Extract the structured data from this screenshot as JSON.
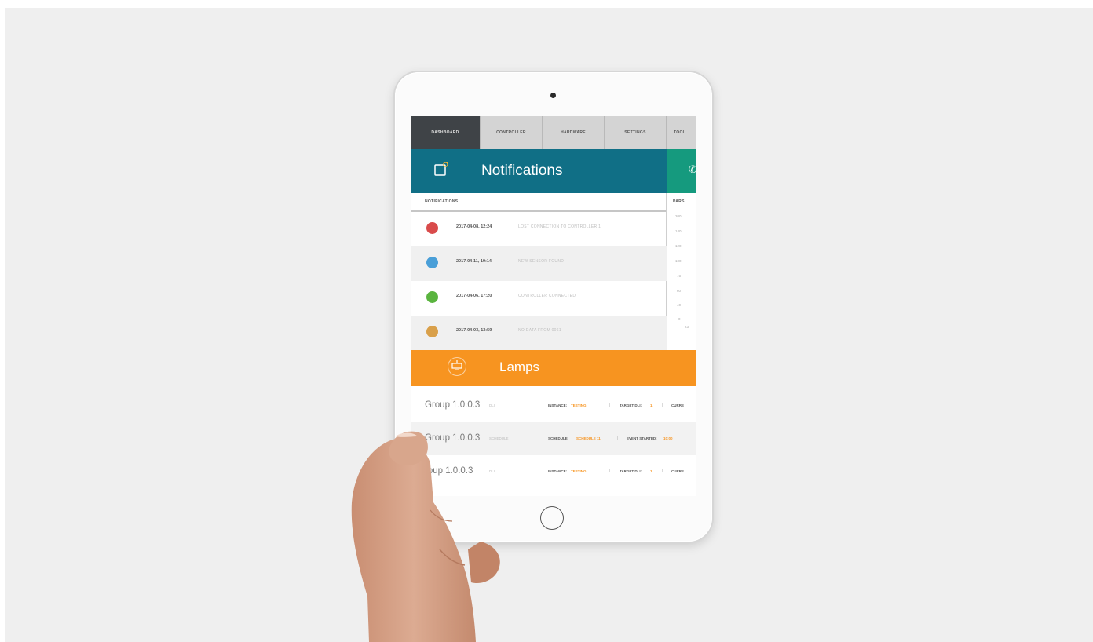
{
  "tabs": [
    "DASHBOARD",
    "CONTROLLER",
    "HARDWARE",
    "SETTINGS",
    "TOOL"
  ],
  "notifications": {
    "title": "Notifications",
    "column_label": "NOTIFICATIONS",
    "side_column_label": "PARS",
    "rows": [
      {
        "date": "2017-04-08, 12:24",
        "message": "LOST CONNECTION TO CONTROLLER 1",
        "color": "#d94b4b"
      },
      {
        "date": "2017-04-11, 19:14",
        "message": "NEW SENSOR FOUND",
        "color": "#4a9fd8"
      },
      {
        "date": "2017-04-06, 17:20",
        "message": "CONTROLLER CONNECTED",
        "color": "#5ab43f"
      },
      {
        "date": "2017-04-03, 13:59",
        "message": "NO DATA FROM 0061",
        "color": "#d9a04a"
      }
    ],
    "scale_values": [
      "200",
      "140",
      "120",
      "100",
      "75",
      "60",
      "40",
      "0"
    ],
    "scale_extra": "23"
  },
  "lamps": {
    "title": "Lamps",
    "rows": [
      {
        "name": "Group 1.0.0.3",
        "sub": "DLI",
        "k1": "INSTANCE:",
        "v1": "TESTING",
        "k2": "TARGET DLI:",
        "v2": "1",
        "k3": "CURRE"
      },
      {
        "name": "Group 1.0.0.3",
        "sub": "SCHEDULE",
        "k1": "SCHEDULE:",
        "v1": "SCHEDULE 11",
        "k2": "EVENT STARTED:",
        "v2": "10:00",
        "k3": ""
      },
      {
        "name": "roup 1.0.0.3",
        "sub": "DLI",
        "k1": "INSTANCE:",
        "v1": "TESTING",
        "k2": "TARGET DLI:",
        "v2": "1",
        "k3": "CURRE"
      }
    ]
  },
  "colors": {
    "notifications_header": "#106f86",
    "side_header": "#159a7e",
    "lamps_header": "#f79420",
    "active_tab": "#3f4347"
  }
}
